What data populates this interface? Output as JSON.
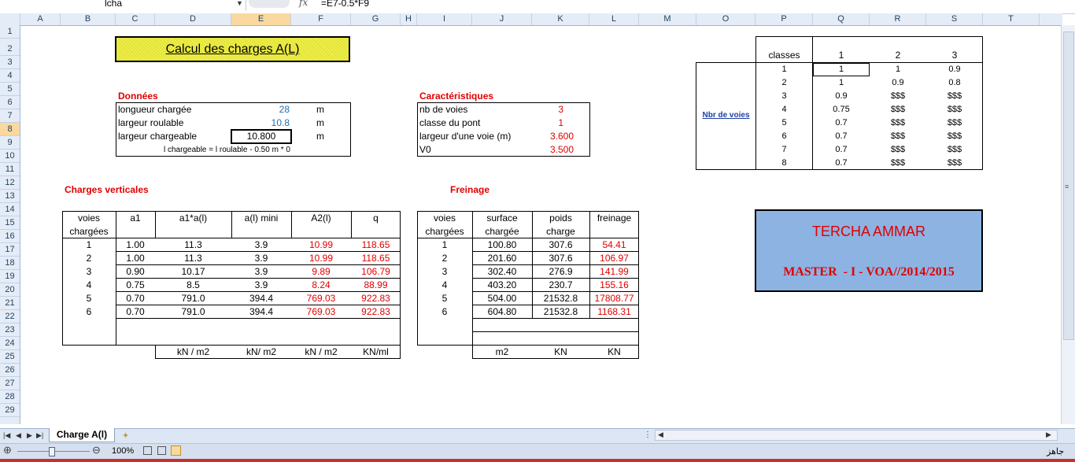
{
  "formula_bar": {
    "name_box": "lcha",
    "fx_label": "fx",
    "formula": "=E7-0.5*F9"
  },
  "columns": [
    "A",
    "B",
    "C",
    "D",
    "E",
    "F",
    "G",
    "H",
    "I",
    "J",
    "K",
    "L",
    "M",
    "O",
    "P",
    "Q",
    "R",
    "S",
    "T"
  ],
  "rows": [
    "1",
    "2",
    "3",
    "4",
    "5",
    "6",
    "7",
    "8",
    "9",
    "10",
    "11",
    "12",
    "13",
    "14",
    "15",
    "16",
    "17",
    "18",
    "19",
    "20",
    "21",
    "22",
    "23",
    "24",
    "25",
    "26",
    "27",
    "28",
    "29"
  ],
  "title": "Calcul des charges A(L)",
  "donnees": {
    "heading": "Données",
    "rows": [
      {
        "label": "longueur chargée",
        "value": "28",
        "unit": "m"
      },
      {
        "label": "largeur roulable",
        "value": "10.8",
        "unit": "m"
      },
      {
        "label": "largeur chargeable",
        "value": "10.800",
        "unit": "m"
      }
    ],
    "note": "l chargeable = l roulable - 0.50 m * 0"
  },
  "caracteristiques": {
    "heading": "Caractéristiques",
    "rows": [
      {
        "label": "nb de voies",
        "value": "3"
      },
      {
        "label": "classe du pont",
        "value": "1"
      },
      {
        "label": "largeur d'une voie (m)",
        "value": "3.600"
      },
      {
        "label": "V0",
        "value": "3.500"
      }
    ]
  },
  "classes_table": {
    "header_label": "classes",
    "class_headers": [
      "1",
      "2",
      "3"
    ],
    "side_label": "Nbr de voies",
    "rows": [
      {
        "n": "1",
        "v": [
          "1",
          "1",
          "0.9"
        ]
      },
      {
        "n": "2",
        "v": [
          "1",
          "0.9",
          "0.8"
        ]
      },
      {
        "n": "3",
        "v": [
          "0.9",
          "$$$",
          "$$$"
        ]
      },
      {
        "n": "4",
        "v": [
          "0.75",
          "$$$",
          "$$$"
        ]
      },
      {
        "n": "5",
        "v": [
          "0.7",
          "$$$",
          "$$$"
        ]
      },
      {
        "n": "6",
        "v": [
          "0.7",
          "$$$",
          "$$$"
        ]
      },
      {
        "n": "7",
        "v": [
          "0.7",
          "$$$",
          "$$$"
        ]
      },
      {
        "n": "8",
        "v": [
          "0.7",
          "$$$",
          "$$$"
        ]
      }
    ]
  },
  "charges_verticales": {
    "heading": "Charges verticales",
    "headers": {
      "voies1": "voies",
      "voies2": "chargées",
      "a1": "a1",
      "a1al": "a1*a(l)",
      "almini": "a(l) mini",
      "a2": "A2(l)",
      "q": "q"
    },
    "rows": [
      [
        "1",
        "1.00",
        "11.3",
        "3.9",
        "10.99",
        "118.65"
      ],
      [
        "2",
        "1.00",
        "11.3",
        "3.9",
        "10.99",
        "118.65"
      ],
      [
        "3",
        "0.90",
        "10.17",
        "3.9",
        "9.89",
        "106.79"
      ],
      [
        "4",
        "0.75",
        "8.5",
        "3.9",
        "8.24",
        "88.99"
      ],
      [
        "5",
        "0.70",
        "791.0",
        "394.4",
        "769.03",
        "922.83"
      ],
      [
        "6",
        "0.70",
        "791.0",
        "394.4",
        "769.03",
        "922.83"
      ]
    ],
    "units": [
      "kN / m2",
      "kN/ m2",
      "kN / m2",
      "KN/ml"
    ]
  },
  "freinage": {
    "heading": "Freinage",
    "headers": {
      "voies1": "voies",
      "voies2": "chargées",
      "s1": "surface",
      "s2": "chargée",
      "p1": "poids",
      "p2": "charge",
      "f": "freinage"
    },
    "rows": [
      [
        "1",
        "100.80",
        "307.6",
        "54.41"
      ],
      [
        "2",
        "201.60",
        "307.6",
        "106.97"
      ],
      [
        "3",
        "302.40",
        "276.9",
        "141.99"
      ],
      [
        "4",
        "403.20",
        "230.7",
        "155.16"
      ],
      [
        "5",
        "504.00",
        "21532.8",
        "17808.77"
      ],
      [
        "6",
        "604.80",
        "21532.8",
        "1168.31"
      ]
    ],
    "units": [
      "m2",
      "KN",
      "KN"
    ]
  },
  "author": {
    "name": "TERCHA AMMAR",
    "line2": "MASTER  - I - VOA//2014/2015",
    "color": "#e00000",
    "bg": "#8db3e2"
  },
  "sheet_tab": "Charge A(l)",
  "status": {
    "zoom": "100%",
    "ready": "جاهز"
  }
}
